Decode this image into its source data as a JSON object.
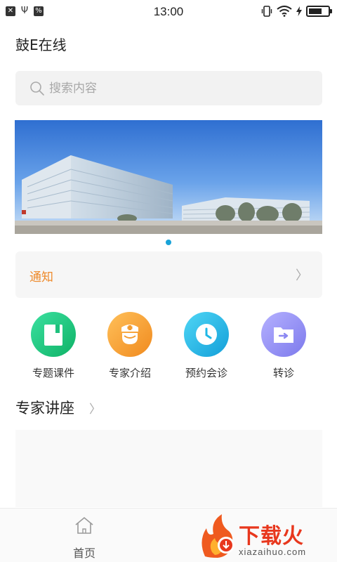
{
  "status_bar": {
    "time": "13:00",
    "left_icons": [
      "close-box-icon",
      "usb-icon",
      "notification-app-icon"
    ],
    "right_icons": [
      "vibrate-icon",
      "wifi-icon",
      "charging-icon",
      "battery-icon"
    ],
    "battery_level": 0.7
  },
  "header": {
    "title": "鼓E在线"
  },
  "search": {
    "placeholder": "搜索内容"
  },
  "banner": {
    "dots_count": 1,
    "active_dot": 0
  },
  "notice": {
    "label": "通知",
    "arrow": "〉"
  },
  "shortcuts": [
    {
      "label": "专题课件",
      "icon": "document-icon",
      "color": "#19c27a"
    },
    {
      "label": "专家介绍",
      "icon": "doctor-icon",
      "color": "#f39b2f"
    },
    {
      "label": "预约会诊",
      "icon": "clock-icon",
      "color": "#1fb7e6"
    },
    {
      "label": "转诊",
      "icon": "folder-transfer-icon",
      "color": "#8b88f2"
    }
  ],
  "section": {
    "title": "专家讲座",
    "arrow": "〉"
  },
  "bottom_nav": {
    "home_label": "首页"
  },
  "watermark": {
    "text": "下载火",
    "sub": "xiazaihuo.com"
  }
}
